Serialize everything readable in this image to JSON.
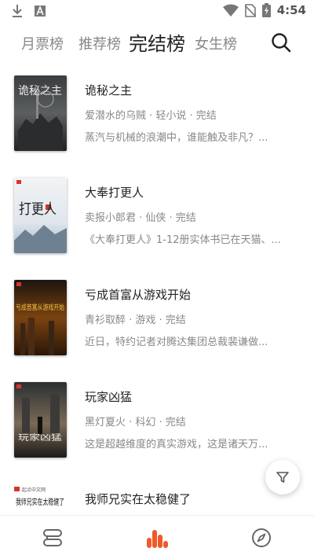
{
  "status_bar": {
    "time": "4:54",
    "left_icons": [
      "download-icon",
      "font-a-icon"
    ],
    "right_icons": [
      "wifi-icon",
      "no-sim-icon",
      "battery-charging-icon"
    ]
  },
  "tabs": [
    {
      "label": "月票榜",
      "active": false
    },
    {
      "label": "推荐榜",
      "active": false
    },
    {
      "label": "完结榜",
      "active": true
    },
    {
      "label": "女生榜",
      "active": false
    }
  ],
  "books": [
    {
      "title": "诡秘之主",
      "meta": "爱潜水的乌贼 · 轻小说 · 完结",
      "desc": "蒸汽与机械的浪潮中，谁能触及非凡？...",
      "cover_text": "诡秘之主"
    },
    {
      "title": "大奉打更人",
      "meta": "卖报小郎君 · 仙侠 · 完结",
      "desc": "《大奉打更人》1-12册实体书已在天猫、...",
      "cover_text": "打更人"
    },
    {
      "title": "亏成首富从游戏开始",
      "meta": "青衫取醉 · 游戏 · 完结",
      "desc": "近日，特约记者对腾达集团总裁裴谦做...",
      "cover_text": "亏成首富从游戏开始"
    },
    {
      "title": "玩家凶猛",
      "meta": "黑灯夏火 · 科幻 · 完结",
      "desc": "这是超越维度的真实游戏，这是诸天万...",
      "cover_text": "玩家凶猛"
    },
    {
      "title": "我师兄实在太稳健了",
      "meta": "",
      "desc": "",
      "cover_text": "我师兄实在太稳健了",
      "cover_brand": "起点中文网"
    }
  ],
  "colors": {
    "accent": "#f05a28",
    "tab_active": "#222222",
    "tab_inactive": "#888888"
  },
  "bottom_nav": [
    {
      "icon": "bookshelf-icon",
      "active": false
    },
    {
      "icon": "ranking-icon",
      "active": true
    },
    {
      "icon": "compass-icon",
      "active": false
    }
  ]
}
